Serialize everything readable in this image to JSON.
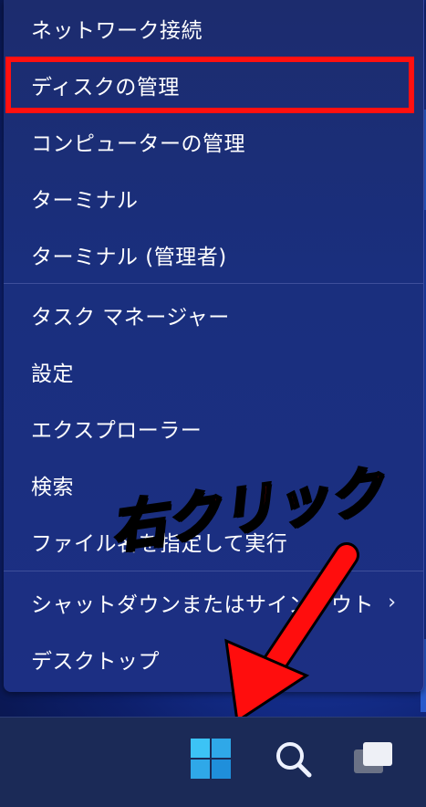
{
  "menu": {
    "items": [
      {
        "label": "ネットワーク接続"
      },
      {
        "label": "ディスクの管理"
      },
      {
        "label": "コンピューターの管理"
      },
      {
        "label": "ターミナル"
      },
      {
        "label": "ターミナル (管理者)"
      },
      {
        "label": "タスク マネージャー"
      },
      {
        "label": "設定"
      },
      {
        "label": "エクスプローラー"
      },
      {
        "label": "検索"
      },
      {
        "label": "ファイル名を指定して実行"
      },
      {
        "label": "シャットダウンまたはサインアウト"
      },
      {
        "label": "デスクトップ"
      }
    ],
    "highlighted_item": "ディスクの管理"
  },
  "annotation": {
    "text": "右クリック",
    "color": "#ff0d0d"
  },
  "taskbar": {
    "buttons": [
      "start-windows-icon",
      "search-icon",
      "task-view-icon"
    ]
  },
  "colors": {
    "highlight_border": "#ff1010",
    "menu_bg": "#1c2c6e",
    "taskbar_bg": "#1b2a57",
    "windows_logo": "#38b6f0"
  }
}
